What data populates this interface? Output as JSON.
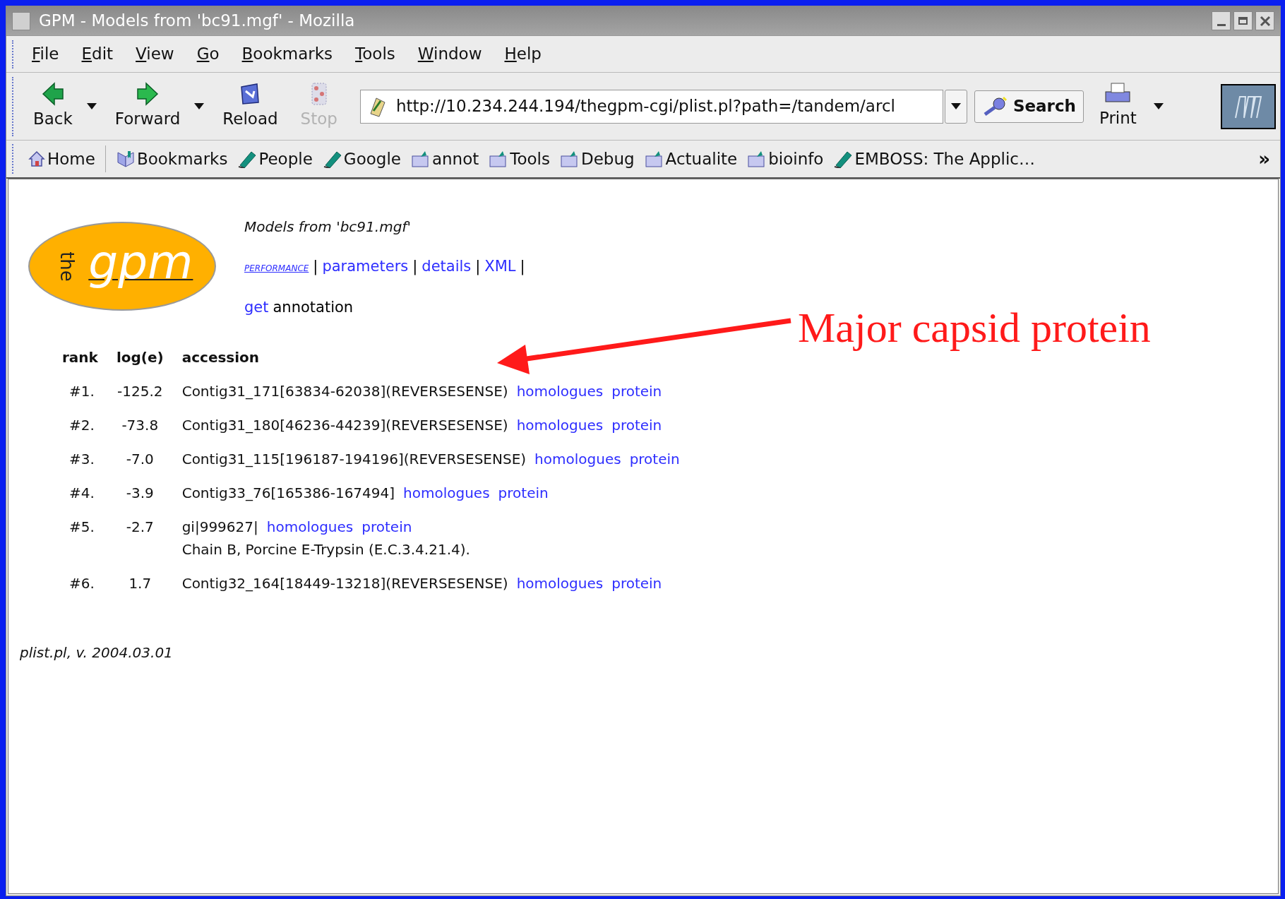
{
  "window": {
    "title": "GPM - Models from 'bc91.mgf' - Mozilla"
  },
  "menu": [
    {
      "label": "File"
    },
    {
      "label": "Edit"
    },
    {
      "label": "View"
    },
    {
      "label": "Go"
    },
    {
      "label": "Bookmarks"
    },
    {
      "label": "Tools"
    },
    {
      "label": "Window"
    },
    {
      "label": "Help"
    }
  ],
  "nav_buttons": [
    {
      "label": "Back",
      "kind": "back",
      "disabled": false,
      "dropdown": true
    },
    {
      "label": "Forward",
      "kind": "forward",
      "disabled": false,
      "dropdown": true
    },
    {
      "label": "Reload",
      "kind": "reload",
      "disabled": false,
      "dropdown": false
    },
    {
      "label": "Stop",
      "kind": "stop",
      "disabled": true,
      "dropdown": false
    }
  ],
  "address": {
    "value": "http://10.234.244.194/thegpm-cgi/plist.pl?path=/tandem/arcl"
  },
  "search_button": "Search",
  "print_button": "Print",
  "bookmarks": [
    {
      "label": "Home",
      "kind": "home"
    },
    {
      "label": "Bookmarks",
      "kind": "manager"
    },
    {
      "label": "People",
      "kind": "link"
    },
    {
      "label": "Google",
      "kind": "link"
    },
    {
      "label": "annot",
      "kind": "folder"
    },
    {
      "label": "Tools",
      "kind": "folder"
    },
    {
      "label": "Debug",
      "kind": "folder"
    },
    {
      "label": "Actualite",
      "kind": "folder"
    },
    {
      "label": "bioinfo",
      "kind": "folder"
    },
    {
      "label": "EMBOSS: The Applic…",
      "kind": "link"
    }
  ],
  "bookmarks_overflow": "»",
  "page": {
    "logo": {
      "small": "the",
      "large": "gpm"
    },
    "heading": "Models from 'bc91.mgf'",
    "nav": [
      {
        "kind": "small-link",
        "text": "PERFORMANCE"
      },
      {
        "kind": "separator",
        "text": "|"
      },
      {
        "kind": "link",
        "text": "parameters"
      },
      {
        "kind": "separator",
        "text": "|"
      },
      {
        "kind": "link",
        "text": "details"
      },
      {
        "kind": "separator",
        "text": "|"
      },
      {
        "kind": "link",
        "text": "XML"
      },
      {
        "kind": "separator",
        "text": "|"
      }
    ],
    "annotation_line": [
      {
        "kind": "link",
        "text": "get"
      },
      {
        "kind": "text",
        "text": "annotation"
      }
    ],
    "table": {
      "columns": [
        "rank",
        "log(e)",
        "accession"
      ],
      "rows": [
        {
          "rank": "#1.",
          "log_e": "-125.2",
          "accession": "Contig31_171[63834-62038](REVERSESENSE)",
          "links": [
            "homologues",
            "protein"
          ]
        },
        {
          "rank": "#2.",
          "log_e": "-73.8",
          "accession": "Contig31_180[46236-44239](REVERSESENSE)",
          "links": [
            "homologues",
            "protein"
          ]
        },
        {
          "rank": "#3.",
          "log_e": "-7.0",
          "accession": "Contig31_115[196187-194196](REVERSESENSE)",
          "links": [
            "homologues",
            "protein"
          ]
        },
        {
          "rank": "#4.",
          "log_e": "-3.9",
          "accession": "Contig33_76[165386-167494]",
          "links": [
            "homologues",
            "protein"
          ]
        },
        {
          "rank": "#5.",
          "log_e": "-2.7",
          "accession": "gi|999627|",
          "links": [
            "homologues",
            "protein"
          ],
          "description": "Chain B, Porcine E-Trypsin (E.C.3.4.21.4)."
        },
        {
          "rank": "#6.",
          "log_e": "1.7",
          "accession": "Contig32_164[18449-13218](REVERSESENSE)",
          "links": [
            "homologues",
            "protein"
          ]
        }
      ]
    },
    "footer": "plist.pl, v. 2004.03.01"
  },
  "callout": {
    "text": "Major capsid protein"
  }
}
